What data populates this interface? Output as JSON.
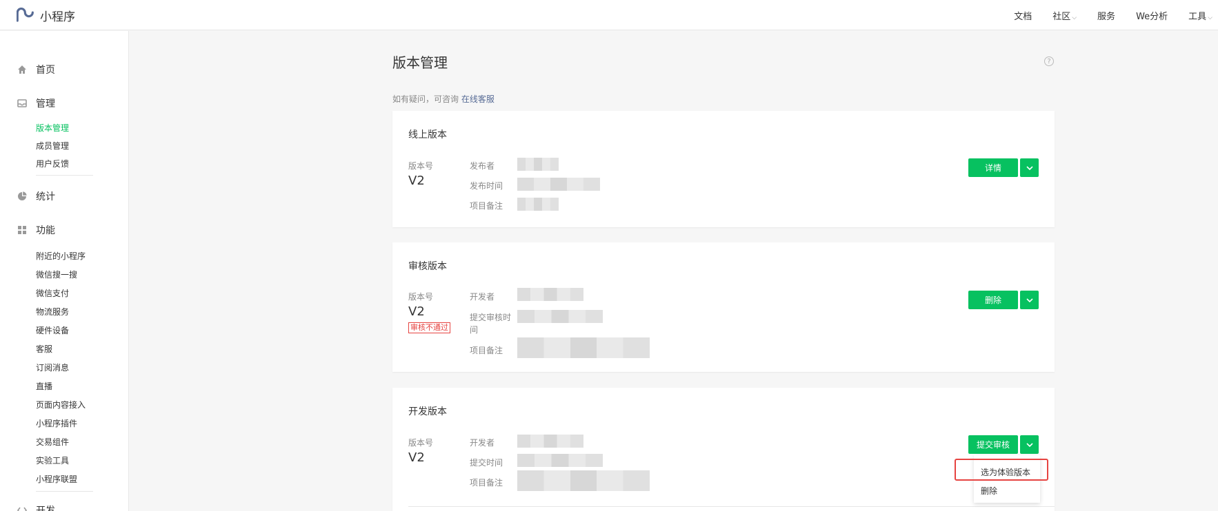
{
  "header": {
    "logo_text": "小程序",
    "nav": [
      {
        "label": "文档"
      },
      {
        "label": "社区"
      },
      {
        "label": "服务"
      },
      {
        "label": "We分析"
      },
      {
        "label": "工具"
      }
    ],
    "brand_color": "#576b95"
  },
  "sidebar": {
    "home": "首页",
    "manage": {
      "label": "管理",
      "items": [
        "版本管理",
        "成员管理",
        "用户反馈"
      ]
    },
    "stats": "统计",
    "features": {
      "label": "功能",
      "items": [
        "附近的小程序",
        "微信搜一搜",
        "微信支付",
        "物流服务",
        "硬件设备",
        "客服",
        "订阅消息",
        "直播",
        "页面内容接入",
        "小程序插件",
        "交易组件",
        "实验工具",
        "小程序联盟"
      ]
    },
    "dev": "开发",
    "active_color": "#07c160"
  },
  "main": {
    "title": "版本管理",
    "help": "?",
    "consult_prefix": "如有疑问，可咨询",
    "consult_link": "在线客服",
    "online": {
      "title": "线上版本",
      "version_label": "版本号",
      "version": "V2",
      "fields": [
        "发布者",
        "发布时间",
        "项目备注"
      ],
      "button": "详情"
    },
    "review": {
      "title": "审核版本",
      "version_label": "版本号",
      "version": "V2",
      "status": "审核不通过",
      "fields": [
        "开发者",
        "提交审核时",
        "间",
        "项目备注"
      ],
      "button": "删除"
    },
    "develop": {
      "title": "开发版本",
      "version_label": "版本号",
      "version": "V2",
      "fields": [
        "开发者",
        "提交时间",
        "项目备注"
      ],
      "button": "提交审核",
      "dropdown": [
        "选为体验版本",
        "删除"
      ]
    },
    "button_color": "#07c160",
    "highlight_color": "#e64340"
  }
}
